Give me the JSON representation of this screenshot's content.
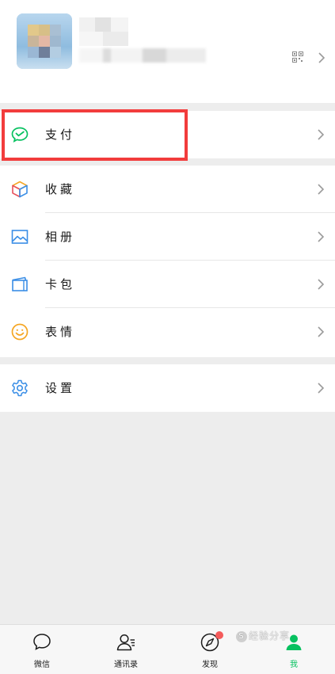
{
  "menu": {
    "groups": [
      [
        {
          "label": "支付",
          "icon": "wechat-pay-icon"
        }
      ],
      [
        {
          "label": "收藏",
          "icon": "favorites-cube-icon"
        },
        {
          "label": "相册",
          "icon": "album-picture-icon"
        },
        {
          "label": "卡包",
          "icon": "card-wallet-icon"
        },
        {
          "label": "表情",
          "icon": "smiley-face-icon"
        }
      ],
      [
        {
          "label": "设置",
          "icon": "settings-gear-icon"
        }
      ]
    ]
  },
  "tabbar": {
    "tabs": [
      {
        "label": "微信",
        "icon": "chat-bubble-icon",
        "active": false
      },
      {
        "label": "通讯录",
        "icon": "contacts-person-icon",
        "active": false
      },
      {
        "label": "发现",
        "icon": "compass-icon",
        "active": false,
        "badge": true
      },
      {
        "label": "我",
        "icon": "me-person-icon",
        "active": true
      }
    ]
  },
  "watermark": {
    "text": "经验分享"
  },
  "colors": {
    "accent_green": "#07c160",
    "highlight_red": "#f23c3c",
    "badge_red": "#f45b5b",
    "pay_green": "#07c160",
    "icon_blue": "#3a8ee6",
    "smiley_orange": "#f5a623"
  }
}
